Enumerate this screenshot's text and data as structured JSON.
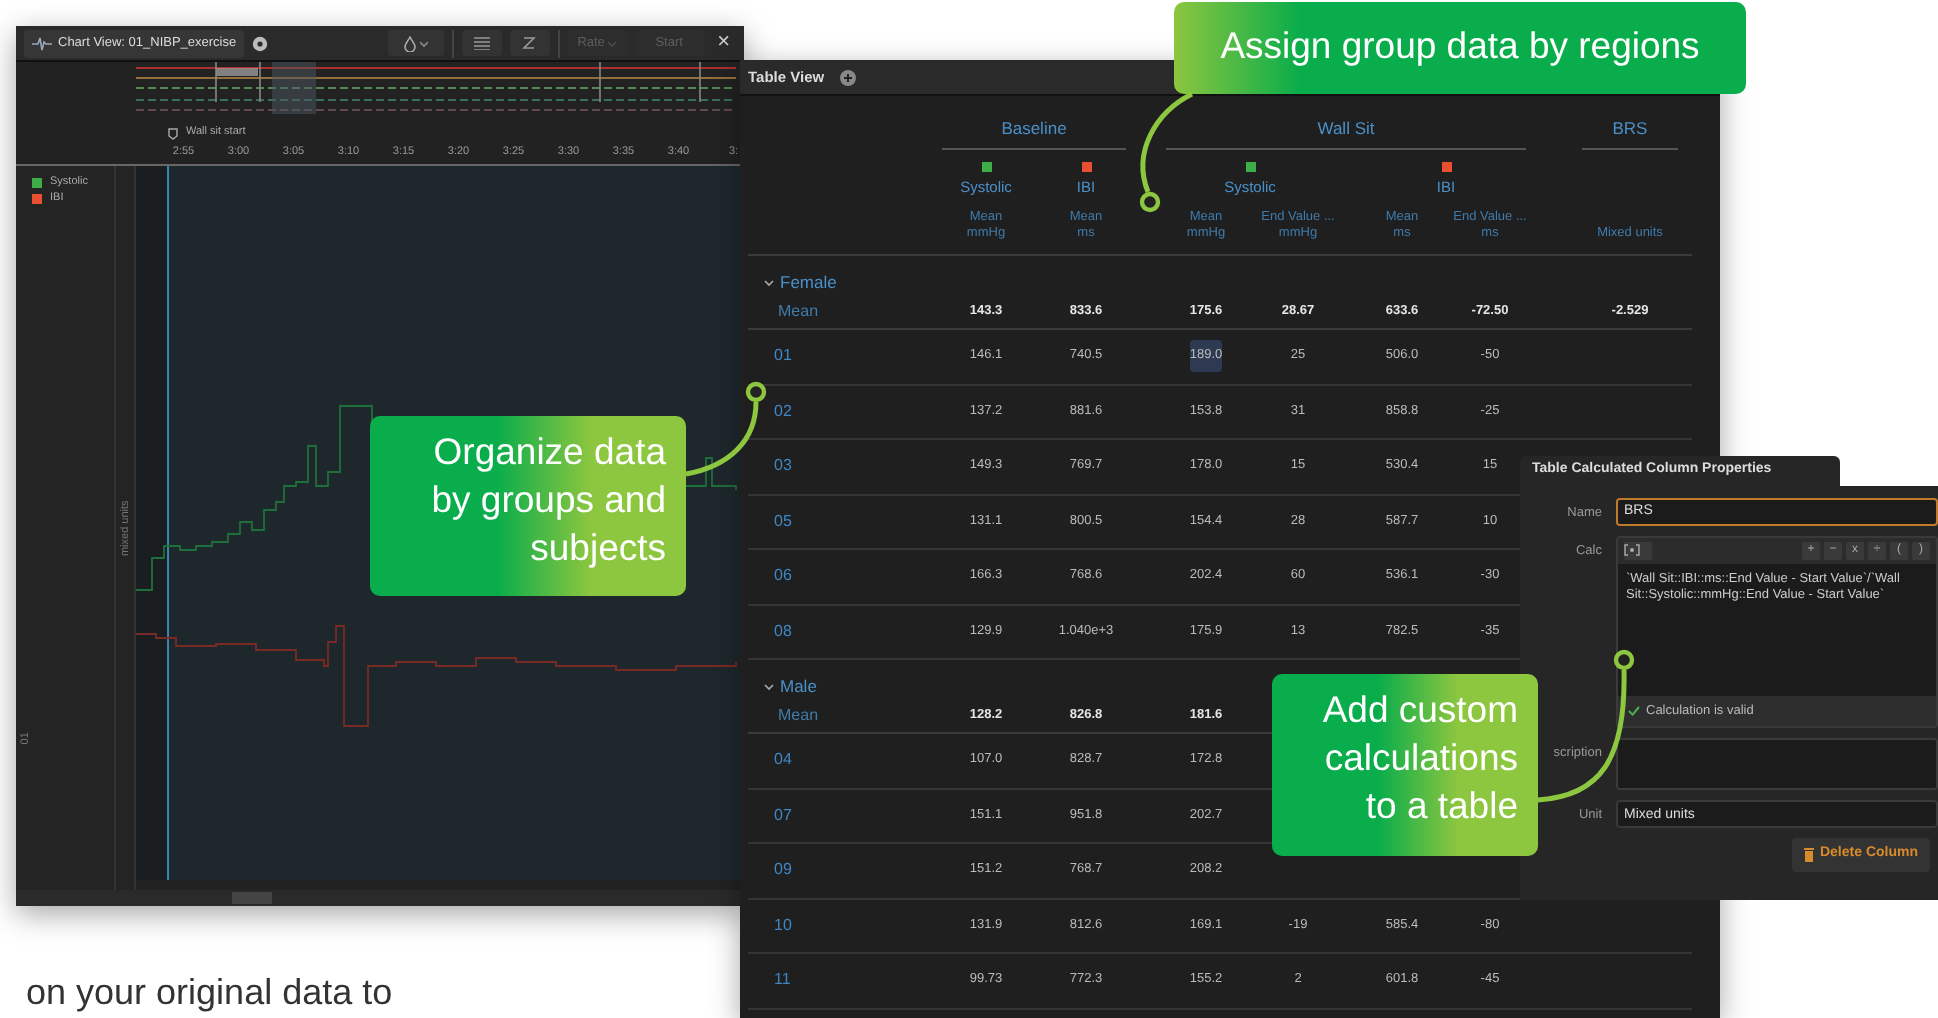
{
  "chart_window": {
    "title": "Chart View: 01_NIBP_exercise",
    "toolbar": [
      {
        "kind": "drop",
        "disabled": false
      },
      {
        "kind": "list",
        "disabled": false
      },
      {
        "kind": "zoom",
        "disabled": false
      },
      {
        "kind": "dropdown",
        "label": "Rate",
        "disabled": true
      },
      {
        "kind": "button",
        "label": "Start",
        "disabled": true
      },
      {
        "kind": "close",
        "label": "×",
        "disabled": false
      }
    ],
    "marker": "Wall sit start",
    "time_ticks": [
      "2:55",
      "3:00",
      "3:05",
      "3:10",
      "3:15",
      "3:20",
      "3:25",
      "3:30",
      "3:35",
      "3:40",
      "3:"
    ],
    "legend": [
      {
        "name": "Systolic",
        "color": "#3fae49"
      },
      {
        "name": "IBI",
        "color": "#e8502f"
      }
    ],
    "axis_label": "mixed units",
    "track": "01"
  },
  "table": {
    "title": "Table View",
    "groups": [
      {
        "name": "Baseline",
        "channels": [
          {
            "name": "Systolic",
            "color": "#3fae49",
            "stats": [
              {
                "name": "Mean",
                "unit": "mmHg"
              }
            ]
          },
          {
            "name": "IBI",
            "color": "#e8502f",
            "stats": [
              {
                "name": "Mean",
                "unit": "ms"
              }
            ]
          }
        ]
      },
      {
        "name": "Wall Sit",
        "channels": [
          {
            "name": "Systolic",
            "color": "#3fae49",
            "stats": [
              {
                "name": "Mean",
                "unit": "mmHg"
              },
              {
                "name": "End Value ...",
                "unit": "mmHg"
              }
            ]
          },
          {
            "name": "IBI",
            "color": "#e8502f",
            "stats": [
              {
                "name": "Mean",
                "unit": "ms"
              },
              {
                "name": "End Value ...",
                "unit": "ms"
              }
            ]
          }
        ]
      },
      {
        "name": "BRS",
        "channels": [
          {
            "stats": [
              {
                "unit": "Mixed units"
              }
            ]
          }
        ]
      }
    ],
    "row_groups": [
      {
        "name": "Female",
        "expanded": true,
        "mean": {
          "label": "Mean",
          "cells": [
            "143.3",
            "833.6",
            "175.6",
            "28.67",
            "633.6",
            "-72.50",
            "-2.529"
          ]
        },
        "rows": [
          {
            "label": "01",
            "cells": [
              {
                "text": "146.1",
                "selected": false
              },
              {
                "text": "740.5",
                "selected": false
              },
              {
                "text": "189.0",
                "selected": true
              },
              {
                "text": "25",
                "selected": false
              },
              {
                "text": "506.0",
                "selected": false
              },
              {
                "text": "-50",
                "selected": false
              }
            ]
          },
          {
            "label": "02",
            "cells": [
              {
                "text": "137.2",
                "selected": false
              },
              {
                "text": "881.6",
                "selected": false
              },
              {
                "text": "153.8",
                "selected": false
              },
              {
                "text": "31",
                "selected": false
              },
              {
                "text": "858.8",
                "selected": false
              },
              {
                "text": "-25",
                "selected": false
              }
            ]
          },
          {
            "label": "03",
            "cells": [
              {
                "text": "149.3",
                "selected": false
              },
              {
                "text": "769.7",
                "selected": false
              },
              {
                "text": "178.0",
                "selected": false
              },
              {
                "text": "15",
                "selected": false
              },
              {
                "text": "530.4",
                "selected": false
              },
              {
                "text": "15",
                "selected": false
              }
            ]
          },
          {
            "label": "05",
            "cells": [
              {
                "text": "131.1",
                "selected": false
              },
              {
                "text": "800.5",
                "selected": false
              },
              {
                "text": "154.4",
                "selected": false
              },
              {
                "text": "28",
                "selected": false
              },
              {
                "text": "587.7",
                "selected": false
              },
              {
                "text": "10",
                "selected": false
              }
            ]
          },
          {
            "label": "06",
            "cells": [
              {
                "text": "166.3",
                "selected": false
              },
              {
                "text": "768.6",
                "selected": false
              },
              {
                "text": "202.4",
                "selected": false
              },
              {
                "text": "60",
                "selected": false
              },
              {
                "text": "536.1",
                "selected": false
              },
              {
                "text": "-30",
                "selected": false
              }
            ]
          },
          {
            "label": "08",
            "cells": [
              {
                "text": "129.9",
                "selected": false
              },
              {
                "text": "1.040e+3",
                "selected": false
              },
              {
                "text": "175.9",
                "selected": false
              },
              {
                "text": "13",
                "selected": false
              },
              {
                "text": "782.5",
                "selected": false
              },
              {
                "text": "-35",
                "selected": false
              }
            ]
          }
        ]
      },
      {
        "name": "Male",
        "expanded": true,
        "mean": {
          "label": "Mean",
          "cells": [
            "128.2",
            "826.8",
            "181.6"
          ]
        },
        "rows": [
          {
            "label": "04",
            "cells": [
              {
                "text": "107.0",
                "selected": false
              },
              {
                "text": "828.7",
                "selected": false
              },
              {
                "text": "172.8",
                "selected": false
              }
            ]
          },
          {
            "label": "07",
            "cells": [
              {
                "text": "151.1",
                "selected": false
              },
              {
                "text": "951.8",
                "selected": false
              },
              {
                "text": "202.7",
                "selected": false
              }
            ]
          },
          {
            "label": "09",
            "cells": [
              {
                "text": "151.2",
                "selected": false
              },
              {
                "text": "768.7",
                "selected": false
              },
              {
                "text": "208.2",
                "selected": false
              }
            ]
          },
          {
            "label": "10",
            "cells": [
              {
                "text": "131.9",
                "selected": false
              },
              {
                "text": "812.6",
                "selected": false
              },
              {
                "text": "169.1",
                "selected": false
              },
              {
                "text": "-19",
                "selected": false
              },
              {
                "text": "585.4",
                "selected": false
              },
              {
                "text": "-80",
                "selected": false
              }
            ]
          },
          {
            "label": "11",
            "cells": [
              {
                "text": "99.73",
                "selected": false
              },
              {
                "text": "772.3",
                "selected": false
              },
              {
                "text": "155.2",
                "selected": false
              },
              {
                "text": "2",
                "selected": false
              },
              {
                "text": "601.8",
                "selected": false
              },
              {
                "text": "-45",
                "selected": false
              }
            ]
          }
        ]
      }
    ]
  },
  "dialog": {
    "title": "Table Calculated Column Properties",
    "fields": [
      {
        "kind": "text",
        "label": "Name",
        "value": "BRS",
        "focused": true
      },
      {
        "kind": "calc",
        "label": "Calc",
        "operators": [
          "+",
          "−",
          "x",
          "÷",
          "(",
          ")"
        ],
        "value": "`Wall Sit::IBI::ms::End Value - Start Value`/`Wall Sit::Systolic::mmHg::End Value - Start Value`",
        "status": "Calculation is valid",
        "valid": true
      },
      {
        "kind": "area",
        "label": "scription"
      },
      {
        "kind": "text",
        "label": "Unit",
        "value": "Mixed units",
        "focused": false
      }
    ],
    "delete_button": "Delete Column"
  },
  "callouts": [
    {
      "text": "Assign group data by regions"
    },
    {
      "text": "Organize data by groups and subjects"
    },
    {
      "text": "Add custom calculations to a table"
    }
  ],
  "footer_text": "on your original data to"
}
